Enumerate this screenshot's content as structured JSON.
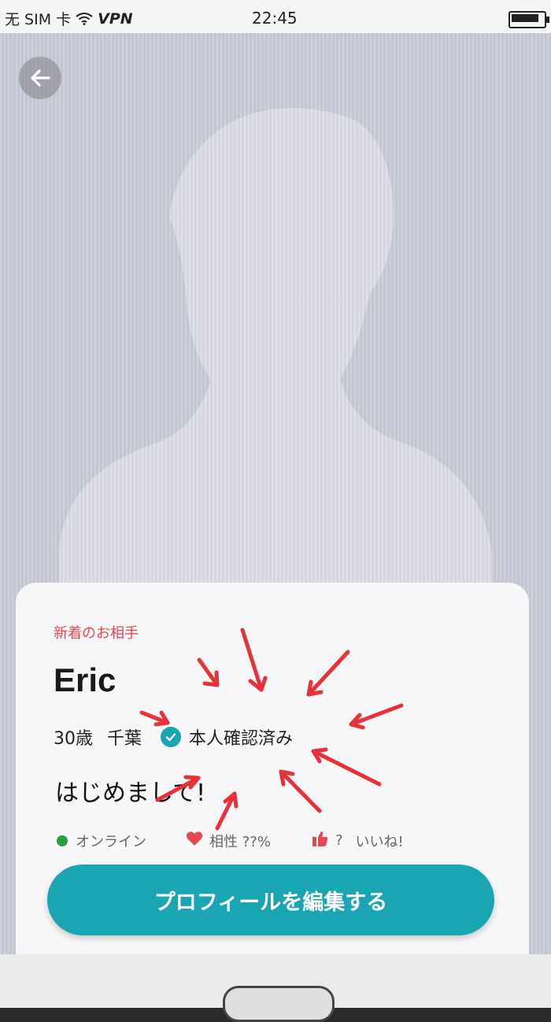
{
  "status_bar": {
    "carrier": "无 SIM 卡",
    "vpn": "VPN",
    "time": "22:45",
    "wifi_icon": "wifi-icon",
    "battery_icon": "battery-icon"
  },
  "header": {
    "back_icon": "arrow-left-icon"
  },
  "profile": {
    "tag": "新着のお相手",
    "name": "Eric",
    "age": "30歳",
    "location": "千葉",
    "verified_label": "本人確認済み",
    "greeting": "はじめまして!",
    "online_label": "オンライン",
    "compat_label": "相性 ??%",
    "likes_count": "?",
    "likes_label": "いいね!"
  },
  "actions": {
    "edit_profile": "プロフィールを編集する"
  },
  "colors": {
    "accent": "#1aa5b3",
    "tag_red": "#e8474f",
    "online_green": "#2b9f3d",
    "annotation_red": "#e8323a"
  }
}
